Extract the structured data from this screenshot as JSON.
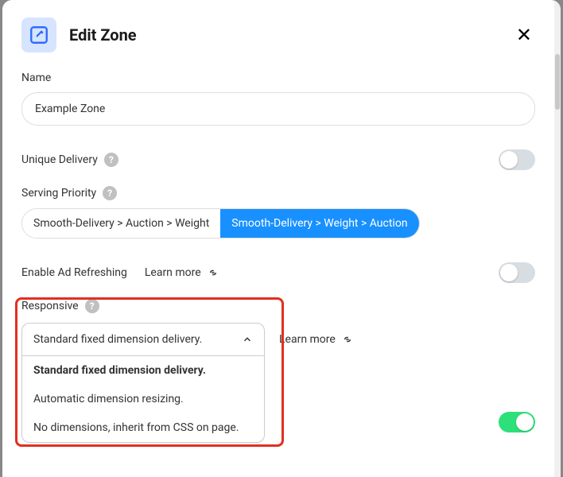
{
  "modal": {
    "title": "Edit Zone"
  },
  "name": {
    "label": "Name",
    "value": "Example Zone"
  },
  "uniqueDelivery": {
    "label": "Unique Delivery",
    "on": false
  },
  "servingPriority": {
    "label": "Serving Priority",
    "options": [
      "Smooth-Delivery > Auction > Weight",
      "Smooth-Delivery > Weight > Auction"
    ],
    "activeIndex": 1
  },
  "adRefreshing": {
    "label": "Enable Ad Refreshing",
    "learnMore": "Learn more",
    "on": false
  },
  "responsive": {
    "label": "Responsive",
    "selected": "Standard fixed dimension delivery.",
    "options": [
      "Standard fixed dimension delivery.",
      "Automatic dimension resizing.",
      "No dimensions, inherit from CSS on page."
    ],
    "learnMore": "Learn more"
  },
  "extra": {
    "toggleOn": true
  }
}
